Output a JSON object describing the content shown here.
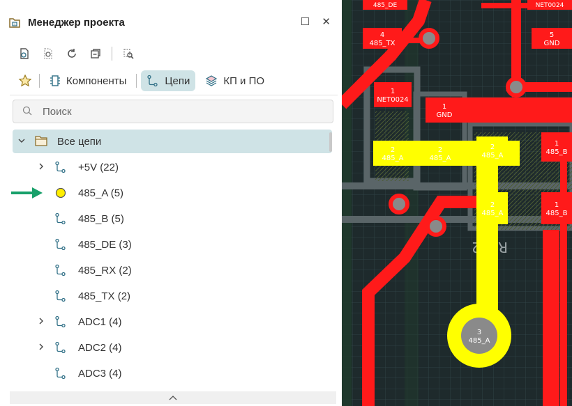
{
  "panel": {
    "title": "Менеджер проекта",
    "maximize_glyph": "☐",
    "close_glyph": "✕"
  },
  "toolbar_icons": [
    "new-doc-icon",
    "find-in-doc-icon",
    "refresh-icon",
    "collapse-icon",
    "locate-icon"
  ],
  "tabs": [
    {
      "label": "",
      "icon": "star-icon",
      "active": false
    },
    {
      "label": "Компоненты",
      "icon": "component-icon",
      "active": false
    },
    {
      "label": "Цепи",
      "icon": "net-icon",
      "active": true
    },
    {
      "label": "КП и ПО",
      "icon": "layers-icon",
      "active": false
    }
  ],
  "search": {
    "placeholder": "Поиск"
  },
  "tree": {
    "root_label": "Все цепи",
    "nets": [
      {
        "label": "+5V (22)",
        "expandable": true,
        "highlighted": false
      },
      {
        "label": "485_A (5)",
        "expandable": false,
        "highlighted": true
      },
      {
        "label": "485_B (5)",
        "expandable": false,
        "highlighted": false
      },
      {
        "label": "485_DE (3)",
        "expandable": false,
        "highlighted": false
      },
      {
        "label": "485_RX (2)",
        "expandable": false,
        "highlighted": false
      },
      {
        "label": "485_TX (2)",
        "expandable": false,
        "highlighted": false
      },
      {
        "label": "ADC1 (4)",
        "expandable": true,
        "highlighted": false
      },
      {
        "label": "ADC2 (4)",
        "expandable": true,
        "highlighted": false
      },
      {
        "label": "ADC3 (4)",
        "expandable": false,
        "highlighted": false
      }
    ]
  },
  "pcb": {
    "pads": [
      {
        "num": "4",
        "net": "485_TX"
      },
      {
        "num": "5",
        "net": "GND"
      },
      {
        "num": "1",
        "net": "NET0024"
      },
      {
        "num": "1",
        "net": "GND"
      },
      {
        "num": "2",
        "net": "485_A"
      },
      {
        "num": "2",
        "net": "485_A"
      },
      {
        "num": "2",
        "net": "485_A"
      },
      {
        "num": "1",
        "net": "485_B"
      },
      {
        "num": "2",
        "net": "485_A"
      },
      {
        "num": "1",
        "net": "485_B"
      },
      {
        "num": "3",
        "net": "485_A"
      }
    ],
    "top_labels": [
      "485_DE",
      "NET0024"
    ],
    "designator": "R112",
    "colors": {
      "net_red": "#ff1a1a",
      "net_yellow": "#ffff00",
      "board": "#1e2a2c",
      "grid": "#33474a"
    }
  }
}
